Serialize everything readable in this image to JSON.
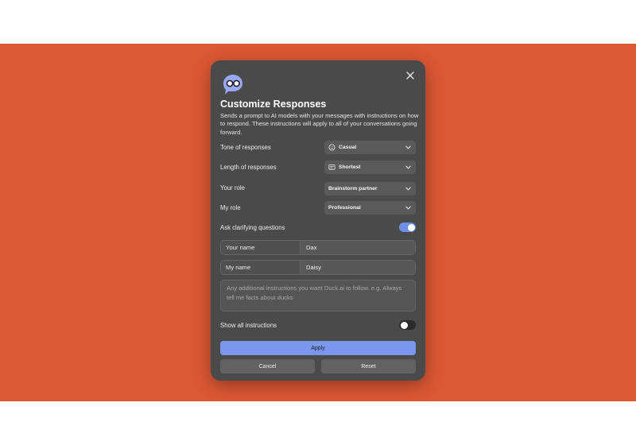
{
  "dialog": {
    "title": "Customize Responses",
    "description": "Sends a prompt to AI models with your messages with instructions on how to respond. These instructions will apply to all of your conversations going forward.",
    "close_icon": "close-icon",
    "logo_icon": "duck-chat-glasses-logo"
  },
  "settings": {
    "tone": {
      "label": "Tone of responses",
      "value": "Casual",
      "icon": "smiley-icon"
    },
    "length": {
      "label": "Length of responses",
      "value": "Shortest",
      "icon": "short-text-icon"
    },
    "your_role": {
      "label": "Your role",
      "value": "Brainstorm partner"
    },
    "my_role": {
      "label": "My role",
      "value": "Professional"
    },
    "clarifying": {
      "label": "Ask clarifying questions",
      "enabled": true
    }
  },
  "fields": {
    "your_name": {
      "label": "Your name",
      "value": "Dax"
    },
    "my_name": {
      "label": "My name",
      "value": "Daisy"
    },
    "instructions": {
      "placeholder": "Any additional instructions you want Duck.ai to follow. e.g. Always tell me facts about ducks",
      "value": ""
    }
  },
  "show_all": {
    "label": "Show all instructions",
    "enabled": false
  },
  "buttons": {
    "apply": "Apply",
    "cancel": "Cancel",
    "reset": "Reset"
  },
  "colors": {
    "backdrop": "#dd5834",
    "dialog": "#4a4a4a",
    "accent": "#7b96ee"
  }
}
